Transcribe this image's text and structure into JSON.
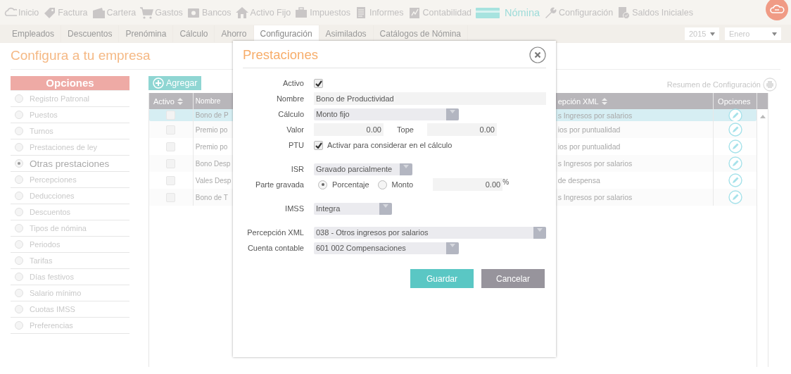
{
  "nav": [
    {
      "label": "Inicio",
      "selected": false
    },
    {
      "label": "Factura",
      "selected": false
    },
    {
      "label": "Cartera",
      "selected": false
    },
    {
      "label": "Gastos",
      "selected": false
    },
    {
      "label": "Bancos",
      "selected": false
    },
    {
      "label": "Activo Fijo",
      "selected": false
    },
    {
      "label": "Impuestos",
      "selected": false
    },
    {
      "label": "Informes",
      "selected": false
    },
    {
      "label": "Contabilidad",
      "selected": false
    },
    {
      "label": "Nómina",
      "selected": true
    },
    {
      "label": "Configuración",
      "selected": false
    },
    {
      "label": "Saldos Iniciales",
      "selected": false
    }
  ],
  "subtabs": [
    {
      "label": "Empleados",
      "selected": false
    },
    {
      "label": "Descuentos",
      "selected": false
    },
    {
      "label": "Prenómina",
      "selected": false
    },
    {
      "label": "Cálculo",
      "selected": false
    },
    {
      "label": "Ahorro",
      "selected": false
    },
    {
      "label": "Configuración",
      "selected": true
    },
    {
      "label": "Asimilados",
      "selected": false
    },
    {
      "label": "Catálogos de Nómina",
      "selected": false
    }
  ],
  "period": {
    "year": "2015",
    "month": "Enero"
  },
  "page_title": "Configura a tu empresa",
  "sidebar": {
    "title": "Opciones",
    "items": [
      {
        "label": "Registro Patronal",
        "selected": false
      },
      {
        "label": "Puestos",
        "selected": false
      },
      {
        "label": "Turnos",
        "selected": false
      },
      {
        "label": "Prestaciones de ley",
        "selected": false
      },
      {
        "label": "Otras prestaciones",
        "selected": true
      },
      {
        "label": "Percepciones",
        "selected": false
      },
      {
        "label": "Deducciones",
        "selected": false
      },
      {
        "label": "Descuentos",
        "selected": false
      },
      {
        "label": "Tipos de nómina",
        "selected": false
      },
      {
        "label": "Periodos",
        "selected": false
      },
      {
        "label": "Tarifas",
        "selected": false
      },
      {
        "label": "Días festivos",
        "selected": false
      },
      {
        "label": "Salario mínimo",
        "selected": false
      },
      {
        "label": "Cuotas IMSS",
        "selected": false
      },
      {
        "label": "Preferencias",
        "selected": false
      }
    ]
  },
  "add_button": "Agregar",
  "summary_link": "Resumen de Configuración",
  "table": {
    "columns": [
      "Activo",
      "Nombre",
      "epción XML",
      "Opciones"
    ],
    "rows": [
      {
        "active": false,
        "selected": true,
        "name": "Bono de P",
        "xml": "s Ingresos por salarios"
      },
      {
        "active": false,
        "selected": false,
        "name": "Premio po",
        "xml": "ios por puntualidad"
      },
      {
        "active": false,
        "selected": false,
        "name": "Premio po",
        "xml": "ios por puntualidad"
      },
      {
        "active": false,
        "selected": false,
        "name": "Bono Desp",
        "xml": "s Ingresos por salarios"
      },
      {
        "active": false,
        "selected": false,
        "name": "Vales Desp",
        "xml": "de despensa"
      },
      {
        "active": false,
        "selected": false,
        "name": "Bono de T",
        "xml": "s Ingresos por salarios"
      }
    ]
  },
  "dialog": {
    "title": "Prestaciones",
    "activo": {
      "label": "Activo",
      "checked": true
    },
    "nombre": {
      "label": "Nombre",
      "value": "Bono de Productividad"
    },
    "calculo": {
      "label": "Cálculo",
      "value": "Monto fijo"
    },
    "valor": {
      "label": "Valor",
      "value": "0.00"
    },
    "tope": {
      "label": "Tope",
      "value": "0.00"
    },
    "ptu": {
      "label": "PTU",
      "checked": true,
      "text": "Activar para considerar en el cálculo"
    },
    "isr": {
      "label": "ISR",
      "value": "Gravado parcialmente"
    },
    "parte_gravada": {
      "label": "Parte gravada",
      "options": [
        {
          "label": "Porcentaje",
          "selected": true
        },
        {
          "label": "Monto",
          "selected": false
        }
      ],
      "value": "0.00",
      "unit": "%"
    },
    "imss": {
      "label": "IMSS",
      "value": "Integra"
    },
    "percepcion_xml": {
      "label": "Percepción XML",
      "value": "038 - Otros ingresos por salarios"
    },
    "cuenta_contable": {
      "label": "Cuenta contable",
      "value": "601 002 Compensaciones"
    },
    "buttons": [
      "Guardar",
      "Cancelar"
    ]
  }
}
